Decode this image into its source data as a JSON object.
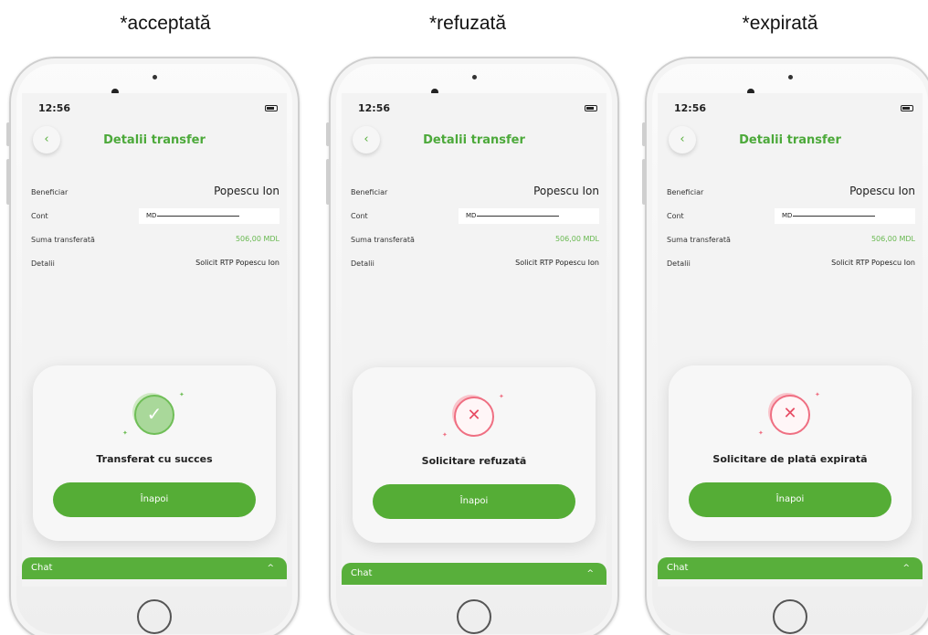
{
  "captions": [
    "*acceptată",
    "*refuzată",
    "*expirată"
  ],
  "screen": {
    "time": "12:56",
    "title": "Detalii transfer",
    "back_icon": "‹",
    "beneficiary_label": "Beneficiar",
    "beneficiary_value": "Popescu Ion",
    "account_label": "Cont",
    "account_prefix": "MD",
    "amount_label": "Suma transferată",
    "amount_value": "506,00 MDL",
    "details_label": "Detalii",
    "details_value": "Solicit RTP Popescu Ion",
    "button_label": "Înapoi",
    "chat_label": "Chat",
    "chat_chevron": "^"
  },
  "states": [
    {
      "message": "Transferat cu succes",
      "icon": "check-circle-icon",
      "glyph": "✓"
    },
    {
      "message": "Solicitare refuzată",
      "icon": "x-circle-icon",
      "glyph": "✕"
    },
    {
      "message": "Solicitare de plată expirată",
      "icon": "x-circle-icon",
      "glyph": "✕"
    }
  ],
  "colors": {
    "brand_green": "#55ad36",
    "error_red": "#e74b63",
    "amount_green": "#67b84f"
  }
}
